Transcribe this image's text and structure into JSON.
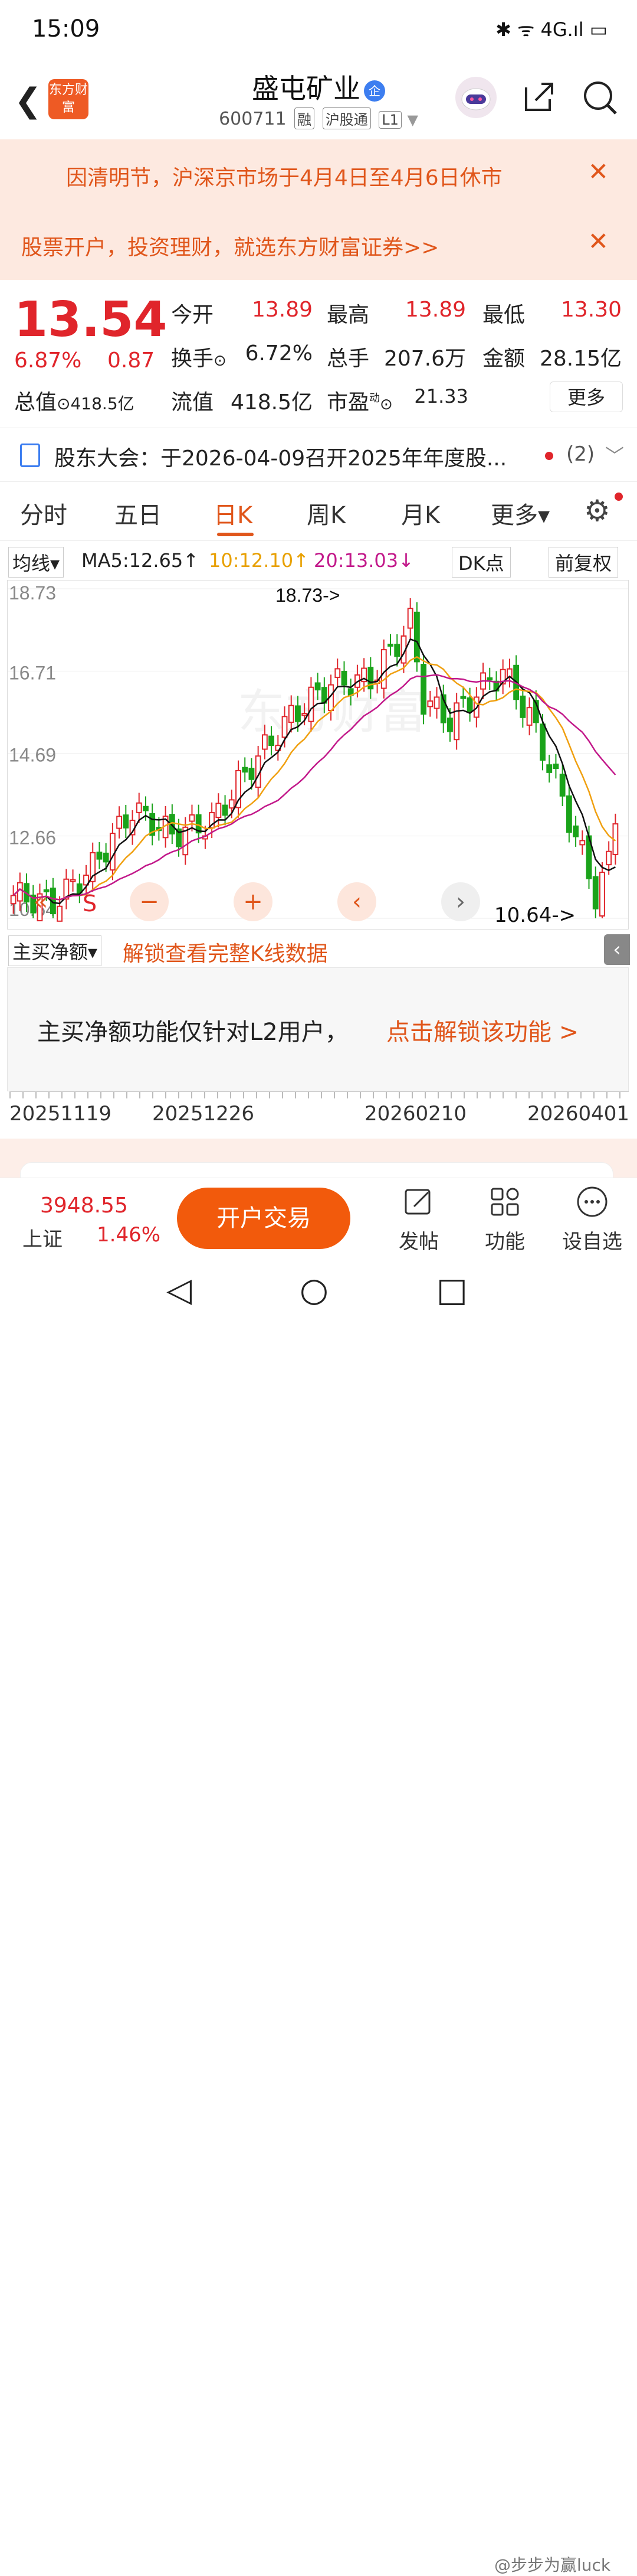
{
  "status": {
    "time": "15:09",
    "icons": "✱ ᯤ 4G.ıl ▭"
  },
  "header": {
    "logo_text": "东方财富",
    "stock_name": "盛屯矿业",
    "qi_badge": "企",
    "stock_code": "600711",
    "tags": [
      "融",
      "沪股通",
      "L1"
    ]
  },
  "notices": [
    {
      "text": "因清明节，沪深京市场于4月4日至4月6日休市",
      "close": "✕"
    },
    {
      "text": "股票开户，投资理财，就选东方财富证券>>",
      "close": "✕"
    }
  ],
  "quote": {
    "price": "13.54",
    "change_pct": "6.87%",
    "change": "0.87",
    "total_value_label": "总值",
    "total_value": "418.5亿",
    "open_label": "今开",
    "open": "13.89",
    "high_label": "最高",
    "high": "13.89",
    "low_label": "最低",
    "low": "13.30",
    "turnover_label": "换手",
    "turnover": "6.72%",
    "volume_label": "总手",
    "volume": "207.6万",
    "amount_label": "金额",
    "amount": "28.15亿",
    "float_label": "流值",
    "float_value": "418.5亿",
    "pe_label": "市盈",
    "pe_sup": "动",
    "pe": "21.33",
    "more_label": "更多"
  },
  "meeting": {
    "text": "股东大会：于2026-04-09召开2025年年度股...",
    "count": "(2)"
  },
  "tabs": [
    "分时",
    "五日",
    "日K",
    "周K",
    "月K",
    "更多▾"
  ],
  "active_tab": "日K",
  "ma": {
    "selector": "均线▾",
    "ma5": "MA5:12.65↑",
    "ma10": "10:12.10↑",
    "ma20": "20:13.03↓",
    "dk": "DK点",
    "adjust": "前复权"
  },
  "chart_data": {
    "type": "candlestick",
    "y_ticks": [
      "18.73",
      "16.71",
      "14.69",
      "12.66",
      "10.64"
    ],
    "ylim": [
      10.64,
      18.73
    ],
    "high_marker": "18.73->",
    "low_marker": "10.64->",
    "x_ticks": [
      "20251119",
      "20251226",
      "20260210",
      "20260401"
    ],
    "series_colors": {
      "up": "#e0252b",
      "down": "#1aa31a",
      "ma5": "#111111",
      "ma10": "#f0a010",
      "ma20": "#c2188a"
    },
    "watermark": "东方财富"
  },
  "zoom": {
    "signal": "S",
    "buttons": [
      "«",
      "−",
      "+",
      "‹",
      "›"
    ]
  },
  "indicator": {
    "selector": "主买净额▾",
    "unlock": "解锁查看完整K线数据",
    "toggle": "‹"
  },
  "l2": {
    "text": "主买净额功能仅针对L2用户，",
    "link": "点击解锁该功能 >"
  },
  "bottom": {
    "index_value": "3948.55",
    "index_name": "上证",
    "index_pct": "1.46%",
    "trade_label": "开户交易",
    "post_label": "发帖",
    "func_label": "功能",
    "watch_label": "设自选"
  },
  "watermark": "@步步为赢luck"
}
